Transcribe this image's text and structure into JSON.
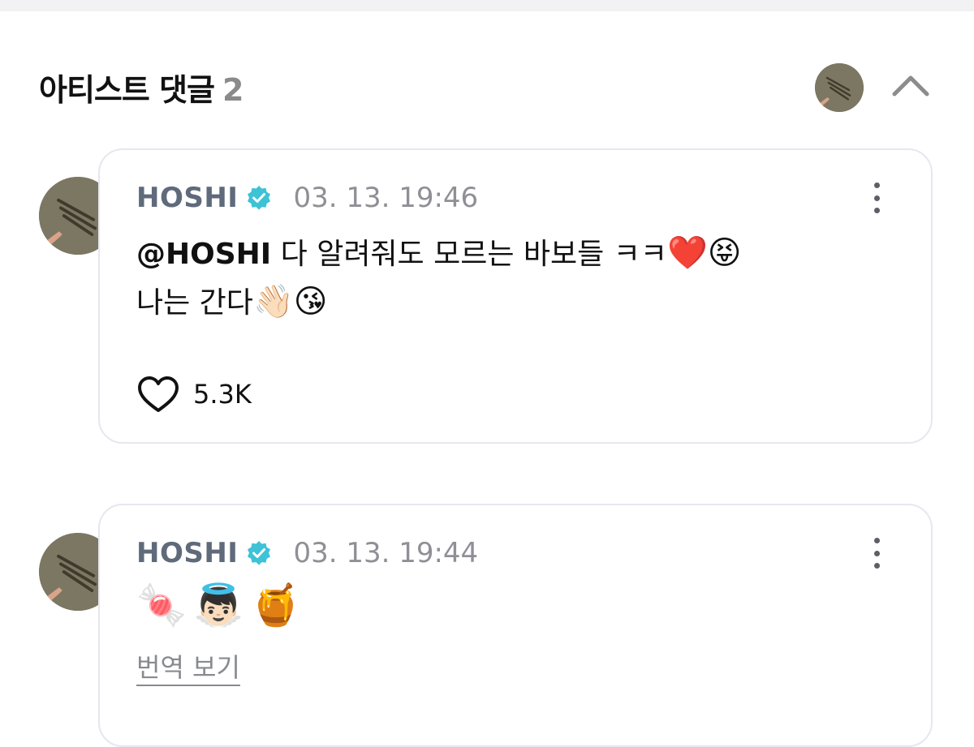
{
  "header": {
    "title": "아티스트 댓글",
    "count": "2",
    "avatar_icon": "artist-avatar",
    "collapse_icon": "chevron-up-icon"
  },
  "comments": [
    {
      "author": "HOSHI",
      "verified_icon": "verified-badge-icon",
      "timestamp": "03. 13. 19:46",
      "mention": "@HOSHI",
      "line1_text": " 다 알려줘도 모르는 바보들 ㅋㅋ",
      "line1_emojis": "❤️😝",
      "line2_text": "나는 간다",
      "line2_emojis": "👋🏻😘",
      "like_icon": "heart-outline-icon",
      "likes": "5.3K"
    },
    {
      "author": "HOSHI",
      "verified_icon": "verified-badge-icon",
      "timestamp": "03. 13. 19:44",
      "emojis": [
        "🍬",
        "👼🏻",
        "🍯"
      ],
      "translate_label": "번역 보기"
    }
  ],
  "colors": {
    "author": "#5f6a7a",
    "timestamp": "#8f8f96",
    "verified": "#3ec2d6",
    "card_border": "#e6e7ef",
    "header_count": "#8a8a8a"
  }
}
